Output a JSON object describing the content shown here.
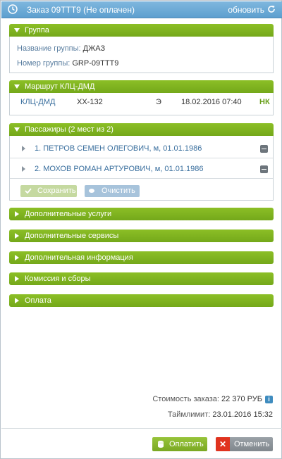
{
  "window": {
    "title": "Заказ 09TTT9 (Не оплачен)",
    "refresh_label": "обновить"
  },
  "group": {
    "header": "Группа",
    "name_label": "Название группы:",
    "name_value": "ДЖАЗ",
    "number_label": "Номер группы:",
    "number_value": "GRP-09TTT9"
  },
  "route": {
    "header": "Маршрут КЛЦ-ДМД",
    "segment": "КЛЦ-ДМД",
    "flight": "XX-132",
    "class": "Э",
    "datetime": "18.02.2016 07:40",
    "status": "НК"
  },
  "passengers": {
    "header": "Пассажиры (2 мест из 2)",
    "items": [
      {
        "text": "1. ПЕТРОВ СЕМЕН ОЛЕГОВИЧ, м, 01.01.1986"
      },
      {
        "text": "2. МОХОВ РОМАН АРТУРОВИЧ, м, 01.01.1986"
      }
    ],
    "save_label": "Сохранить",
    "clear_label": "Очистить"
  },
  "collapsed_sections": [
    {
      "label": "Дополнительные услуги"
    },
    {
      "label": "Дополнительные сервисы"
    },
    {
      "label": "Дополнительная информация"
    },
    {
      "label": "Комиссия и сборы"
    },
    {
      "label": "Оплата"
    }
  ],
  "summary": {
    "cost_label": "Стоимость заказа:",
    "cost_value": "22 370 РУБ",
    "timelimit_label": "Таймлимит:",
    "timelimit_value": "23.01.2016 15:32"
  },
  "footer": {
    "pay_label": "Оплатить",
    "cancel_label": "Отменить"
  },
  "colors": {
    "titlebar": "#5d9fcf",
    "section_header": "#7fb31f",
    "link_blue": "#3a6f9e",
    "cancel_red": "#e0331f"
  }
}
